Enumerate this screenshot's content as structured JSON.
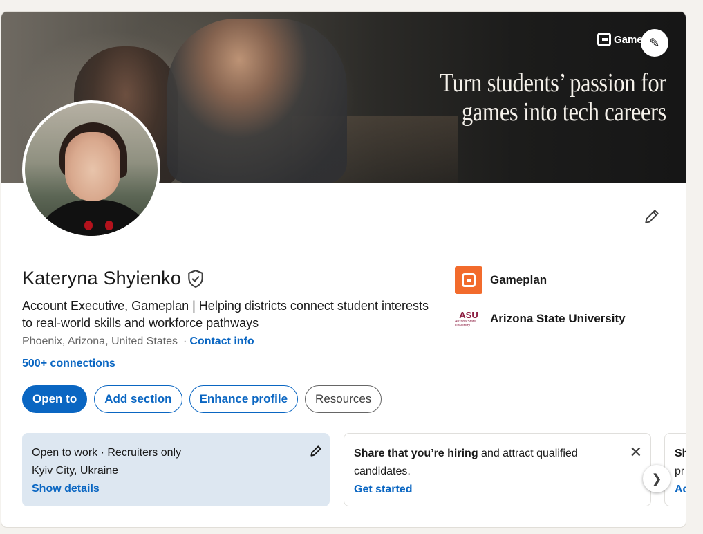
{
  "banner": {
    "brand_text": "Gameplan",
    "headline_line1": "Turn students’ passion for",
    "headline_line2": "games into tech careers",
    "edit_icon": "pencil-icon"
  },
  "profile": {
    "name": "Kateryna Shyienko",
    "verified_icon": "shield-check-icon",
    "headline": "Account Executive, Gameplan | Helping districts connect student interests to real-world skills and workforce pathways",
    "location": "Phoenix, Arizona, United States",
    "separator": "·",
    "contact_info": "Contact info",
    "connections": "500+ connections"
  },
  "orgs": [
    {
      "name": "Gameplan",
      "logo": "gameplan-logo"
    },
    {
      "name": "Arizona State University",
      "logo": "asu-logo",
      "logo_text": "ASU",
      "logo_sub": "Arizona State University"
    }
  ],
  "buttons": {
    "open_to": "Open to",
    "add_section": "Add section",
    "enhance_profile": "Enhance profile",
    "resources": "Resources"
  },
  "cards": {
    "open_to_work": {
      "title": "Open to work · Recruiters only",
      "location": "Kyiv City, Ukraine",
      "link": "Show details"
    },
    "hiring": {
      "title_bold": "Share that you’re hiring",
      "title_rest": " and attract qualified candidates.",
      "link": "Get started"
    },
    "third": {
      "line1": "Sh",
      "line2": "pr",
      "line3": "Ad"
    }
  },
  "colors": {
    "link_blue": "#0a66c2",
    "gameplan_orange": "#f26b2c",
    "asu_maroon": "#8c1d40",
    "open_to_work_bg": "#dde7f1"
  }
}
